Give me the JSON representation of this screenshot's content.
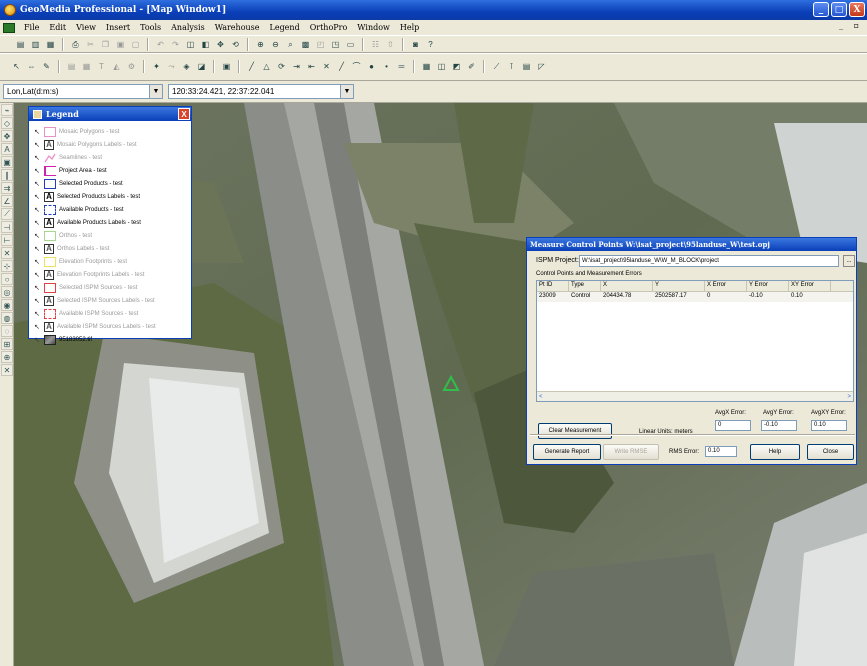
{
  "window": {
    "title": "GeoMedia Professional - [Map Window1]",
    "btn_min": "_",
    "btn_max": "□",
    "btn_close": "X"
  },
  "menu": {
    "items": [
      "File",
      "Edit",
      "View",
      "Insert",
      "Tools",
      "Analysis",
      "Warehouse",
      "Legend",
      "OrthoPro",
      "Window",
      "Help"
    ],
    "mdi_controls": "_ ▫"
  },
  "coords": {
    "system": "Lon,Lat(d:m:s)",
    "value": "120:33:24.421, 22:37:22.041"
  },
  "legend": {
    "title": "Legend",
    "close": "X",
    "entries": [
      {
        "label": "Mosaic Polygons - test",
        "symbol": "box-pink",
        "dim": true
      },
      {
        "label": "Mosaic Polygons Labels - test",
        "symbol": "A",
        "dim": true
      },
      {
        "label": "Seamlines - test",
        "symbol": "line-pink",
        "dim": true
      },
      {
        "label": "Project Area - test",
        "symbol": "bracket-magenta",
        "dim": false
      },
      {
        "label": "Selected Products - test",
        "symbol": "box-blue",
        "dim": false
      },
      {
        "label": "Selected Products Labels - test",
        "symbol": "A",
        "dim": false
      },
      {
        "label": "Available Products - test",
        "symbol": "dash-blue",
        "dim": false
      },
      {
        "label": "Available Products Labels - test",
        "symbol": "A",
        "dim": false
      },
      {
        "label": "Orthos - test",
        "symbol": "box-green",
        "dim": true
      },
      {
        "label": "Orthos Labels - test",
        "symbol": "A",
        "dim": true
      },
      {
        "label": "Elevation Footprints - test",
        "symbol": "box-yellow",
        "dim": true
      },
      {
        "label": "Elevation Footprints Labels - test",
        "symbol": "A",
        "dim": true
      },
      {
        "label": "Selected ISPM Sources - test",
        "symbol": "box-red",
        "dim": true
      },
      {
        "label": "Selected ISPM Sources Labels - test",
        "symbol": "A",
        "dim": true
      },
      {
        "label": "Available ISPM Sources - test",
        "symbol": "dash-red",
        "dim": true
      },
      {
        "label": "Available ISPM Sources Labels - test",
        "symbol": "A",
        "dim": true
      },
      {
        "label": "95183052.tif",
        "symbol": "image",
        "dim": false
      }
    ]
  },
  "dialog": {
    "title": "Measure Control Points W:\\isat_project\\95landuse_W\\test.opj",
    "project_label": "ISPM Project:",
    "project_path": "W:\\isat_project\\95landuse_W\\W_M_BLOCK\\project",
    "browse": "...",
    "group_label": "Control Points and Measurement Errors",
    "columns": [
      "Pt ID",
      "Type",
      "X",
      "Y",
      "X Error",
      "Y Error",
      "XY Error"
    ],
    "rows": [
      [
        "23009",
        "Control",
        "204434.78",
        "2502587.17",
        "0",
        "-0.10",
        "0.10"
      ]
    ],
    "scroll_left": "<",
    "scroll_right": ">",
    "clear_btn": "Clear Measurement",
    "linear_units": "Linear Units: meters",
    "avg_x_label": "AvgX Error:",
    "avg_x": "0",
    "avg_y_label": "AvgY Error:",
    "avg_y": "-0.10",
    "avg_xy_label": "AvgXY Error:",
    "avg_xy": "0.10",
    "generate_btn": "Generate Report",
    "write_btn": "Write RMSE",
    "rms_label": "RMS Error:",
    "rms": "0.10",
    "help_btn": "Help",
    "close_btn": "Close"
  },
  "map": {
    "control_point_marker": "triangle-green"
  },
  "colors": {
    "title_blue": "#0a3fb8",
    "chrome": "#ece9d8",
    "marker_green": "#2fbf4a"
  }
}
